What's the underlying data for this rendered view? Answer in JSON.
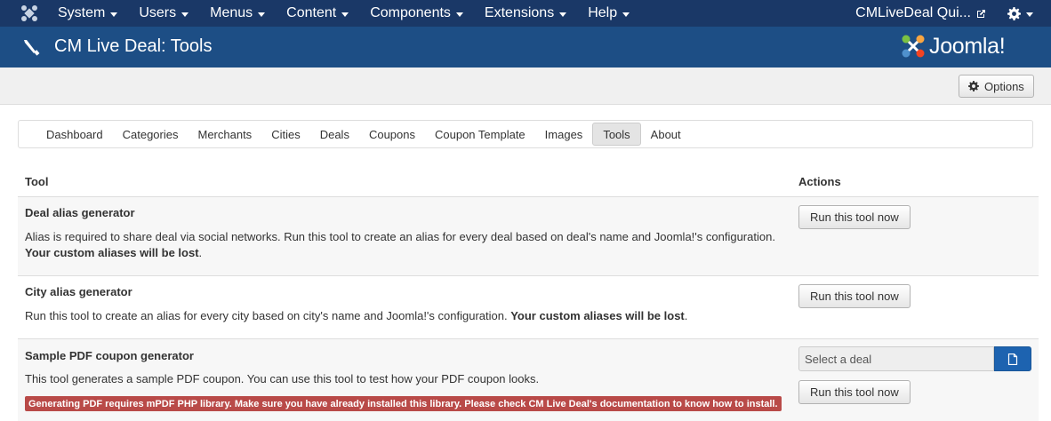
{
  "navbar": {
    "menu": [
      {
        "label": "System"
      },
      {
        "label": "Users"
      },
      {
        "label": "Menus"
      },
      {
        "label": "Content"
      },
      {
        "label": "Components"
      },
      {
        "label": "Extensions"
      },
      {
        "label": "Help"
      }
    ],
    "site_link": "CMLiveDeal Qui...",
    "icons": {
      "logo": "joomla-icon",
      "external": "external-link-icon",
      "user": "gear-icon"
    }
  },
  "header": {
    "title": "CM Live Deal: Tools",
    "logo_text": "Joomla!",
    "icon": "wrench-icon"
  },
  "toolbar": {
    "options_label": "Options"
  },
  "submenu": {
    "tabs": [
      {
        "label": "Dashboard"
      },
      {
        "label": "Categories"
      },
      {
        "label": "Merchants"
      },
      {
        "label": "Cities"
      },
      {
        "label": "Deals"
      },
      {
        "label": "Coupons"
      },
      {
        "label": "Coupon Template"
      },
      {
        "label": "Images"
      },
      {
        "label": "Tools",
        "active": true
      },
      {
        "label": "About"
      }
    ]
  },
  "table": {
    "headers": {
      "tool": "Tool",
      "actions": "Actions"
    },
    "rows": [
      {
        "name": "Deal alias generator",
        "desc": "Alias is required to share deal via social networks. Run this tool to create an alias for every deal based on deal's name and Joomla!'s configuration.",
        "desc_strong": "Your custom aliases will be lost",
        "desc_end": ".",
        "button": "Run this tool now"
      },
      {
        "name": "City alias generator",
        "desc": "Run this tool to create an alias for every city based on city's name and Joomla!'s configuration.",
        "desc_strong": "Your custom aliases will be lost",
        "desc_end": ".",
        "button": "Run this tool now"
      },
      {
        "name": "Sample PDF coupon generator",
        "desc": "This tool generates a sample PDF coupon. You can use this tool to test how your PDF coupon looks.",
        "warning": "Generating PDF requires mPDF PHP library. Make sure you have already installed this library. Please check CM Live Deal's documentation to know how to install.",
        "select_value": "Select a deal",
        "button": "Run this tool now"
      }
    ]
  },
  "colors": {
    "navbar": "#1a3867",
    "header": "#1d4e85",
    "warning": "#b94a48",
    "select_button": "#1d63b0"
  }
}
